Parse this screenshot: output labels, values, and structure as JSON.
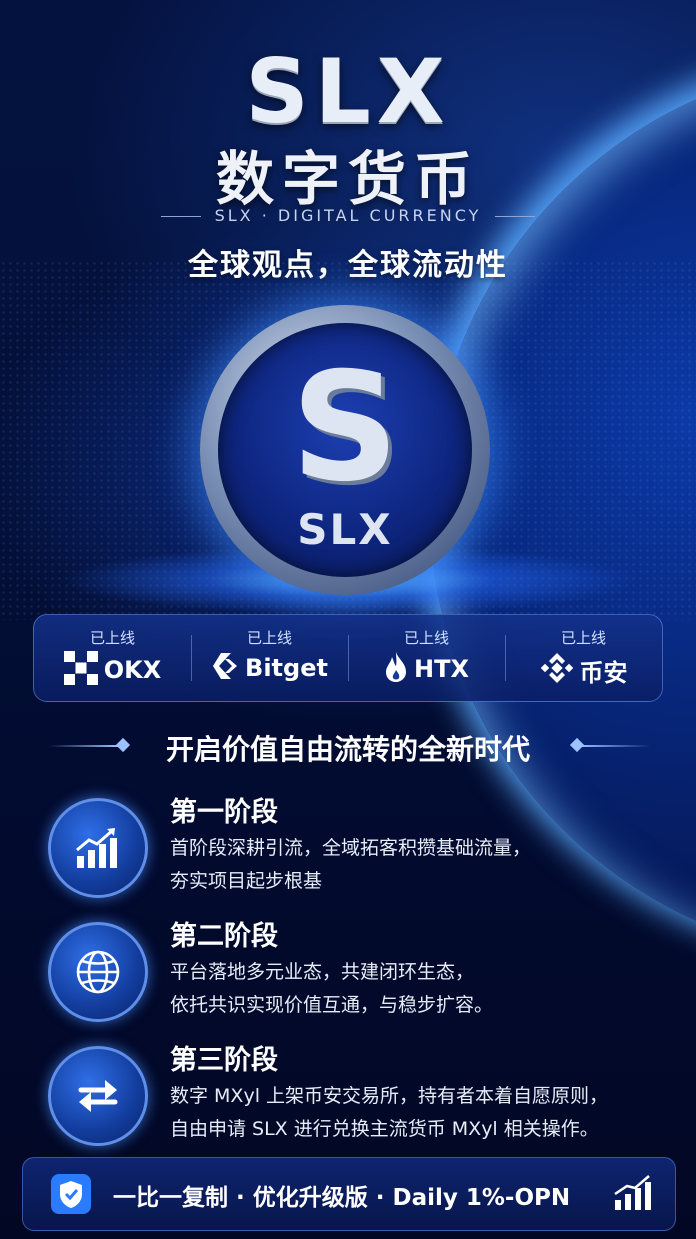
{
  "header": {
    "brand": "SLX",
    "title_cn": "数字货币",
    "subtitle_en": "SLX · DIGITAL CURRENCY",
    "slogan": "全球观点，全球流动性"
  },
  "coin": {
    "letter": "S",
    "label": "SLX"
  },
  "exchanges": [
    {
      "status": "已上线",
      "name": "OKX",
      "icon": "okx-logo-icon"
    },
    {
      "status": "已上线",
      "name": "Bitget",
      "icon": "bitget-logo-icon"
    },
    {
      "status": "已上线",
      "name": "HTX",
      "icon": "htx-flame-icon"
    },
    {
      "status": "已上线",
      "name": "币安",
      "icon": "binance-logo-icon"
    }
  ],
  "section_title": "开启价值自由流转的全新时代",
  "stages": [
    {
      "title": "第一阶段",
      "lines": [
        "首阶段深耕引流，全域拓客积攒基础流量，",
        "夯实项目起步根基"
      ],
      "icon": "growth-chart-icon"
    },
    {
      "title": "第二阶段",
      "lines": [
        "平台落地多元业态，共建闭环生态，",
        "依托共识实现价值互通，与稳步扩容。"
      ],
      "icon": "globe-icon"
    },
    {
      "title": "第三阶段",
      "lines": [
        "数字 MXyl 上架币安交易所，持有者本着自愿原则，",
        "自由申请 SLX 进行兑换主流货币 MXyl 相关操作。"
      ],
      "icon": "exchange-arrows-icon"
    }
  ],
  "footer": {
    "text": "一比一复制 · 优化升级版 · Daily 1%-OPN",
    "left_icon": "shield-icon",
    "right_icon": "bar-chart-icon"
  },
  "colors": {
    "background": "#020a2e",
    "accent": "#2a7bff",
    "glow": "#5fb0ff"
  }
}
